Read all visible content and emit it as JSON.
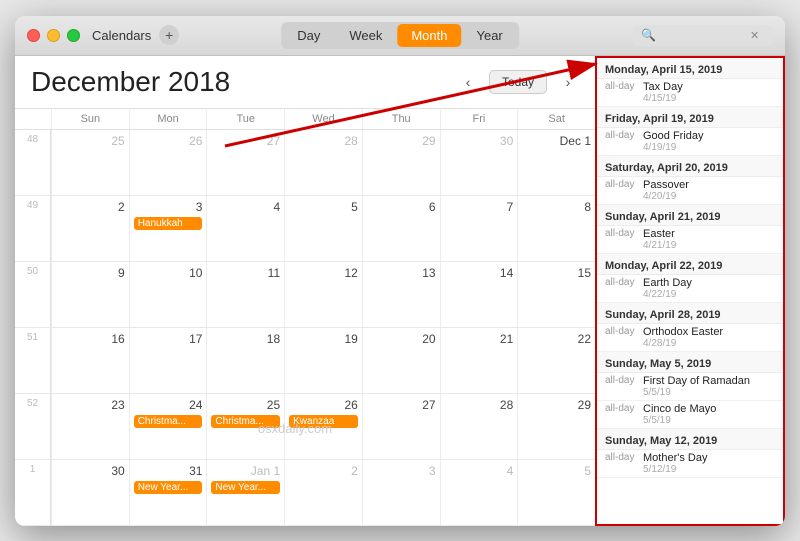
{
  "window": {
    "title": "Calendar"
  },
  "titlebar": {
    "calendars_label": "Calendars",
    "add_label": "+",
    "tabs": [
      "Day",
      "Week",
      "Month",
      "Year"
    ],
    "active_tab": "Month",
    "search_placeholder": ".",
    "search_clear": "✕"
  },
  "calendar": {
    "month_title": "December 2018",
    "prev_label": "‹",
    "next_label": "›",
    "today_label": "Today",
    "day_headers": [
      "Sun",
      "Mon",
      "Tue",
      "Wed",
      "Thu",
      "Fri",
      "Sat"
    ],
    "rows": [
      {
        "week_num": "48",
        "days": [
          {
            "num": "25",
            "other": true,
            "events": []
          },
          {
            "num": "26",
            "other": true,
            "events": []
          },
          {
            "num": "27",
            "other": true,
            "events": []
          },
          {
            "num": "28",
            "other": true,
            "events": []
          },
          {
            "num": "29",
            "other": true,
            "events": []
          },
          {
            "num": "30",
            "other": true,
            "events": []
          },
          {
            "num": "Dec 1",
            "other": false,
            "events": []
          }
        ]
      },
      {
        "week_num": "49",
        "days": [
          {
            "num": "2",
            "other": false,
            "events": []
          },
          {
            "num": "3",
            "other": false,
            "events": [
              {
                "label": "Hanukkah",
                "color": "orange"
              }
            ]
          },
          {
            "num": "4",
            "other": false,
            "events": []
          },
          {
            "num": "5",
            "other": false,
            "events": []
          },
          {
            "num": "6",
            "other": false,
            "events": []
          },
          {
            "num": "7",
            "other": false,
            "events": []
          },
          {
            "num": "8",
            "other": false,
            "events": []
          }
        ]
      },
      {
        "week_num": "50",
        "days": [
          {
            "num": "9",
            "other": false,
            "events": []
          },
          {
            "num": "10",
            "other": false,
            "events": []
          },
          {
            "num": "11",
            "other": false,
            "events": []
          },
          {
            "num": "12",
            "other": false,
            "events": []
          },
          {
            "num": "13",
            "other": false,
            "events": []
          },
          {
            "num": "14",
            "other": false,
            "events": []
          },
          {
            "num": "15",
            "other": false,
            "events": []
          }
        ]
      },
      {
        "week_num": "51",
        "days": [
          {
            "num": "16",
            "other": false,
            "events": []
          },
          {
            "num": "17",
            "other": false,
            "events": []
          },
          {
            "num": "18",
            "other": false,
            "events": []
          },
          {
            "num": "19",
            "other": false,
            "events": []
          },
          {
            "num": "20",
            "other": false,
            "events": []
          },
          {
            "num": "21",
            "other": false,
            "events": []
          },
          {
            "num": "22",
            "other": false,
            "events": []
          }
        ]
      },
      {
        "week_num": "52",
        "days": [
          {
            "num": "23",
            "other": false,
            "events": []
          },
          {
            "num": "24",
            "other": false,
            "events": [
              {
                "label": "Christma...",
                "color": "orange"
              }
            ]
          },
          {
            "num": "25",
            "other": false,
            "events": [
              {
                "label": "Christma...",
                "color": "orange"
              }
            ]
          },
          {
            "num": "26",
            "other": false,
            "events": [
              {
                "label": "Kwanzaa",
                "color": "orange"
              }
            ]
          },
          {
            "num": "27",
            "other": false,
            "events": []
          },
          {
            "num": "28",
            "other": false,
            "events": []
          },
          {
            "num": "29",
            "other": false,
            "events": []
          }
        ]
      },
      {
        "week_num": "1",
        "days": [
          {
            "num": "30",
            "other": false,
            "events": []
          },
          {
            "num": "31",
            "other": false,
            "events": [
              {
                "label": "New Year...",
                "color": "orange"
              }
            ]
          },
          {
            "num": "Jan 1",
            "other": true,
            "events": [
              {
                "label": "New Year...",
                "color": "orange"
              }
            ]
          },
          {
            "num": "2",
            "other": true,
            "events": []
          },
          {
            "num": "3",
            "other": true,
            "events": []
          },
          {
            "num": "4",
            "other": true,
            "events": []
          },
          {
            "num": "5",
            "other": true,
            "events": []
          }
        ]
      }
    ]
  },
  "search_results": {
    "groups": [
      {
        "date_header": "Monday, April 15, 2019",
        "events": [
          {
            "time": "all-day",
            "name": "Tax Day",
            "date": "4/15/19"
          }
        ]
      },
      {
        "date_header": "Friday, April 19, 2019",
        "events": [
          {
            "time": "all-day",
            "name": "Good Friday",
            "date": "4/19/19"
          }
        ]
      },
      {
        "date_header": "Saturday, April 20, 2019",
        "events": [
          {
            "time": "all-day",
            "name": "Passover",
            "date": "4/20/19"
          }
        ]
      },
      {
        "date_header": "Sunday, April 21, 2019",
        "events": [
          {
            "time": "all-day",
            "name": "Easter",
            "date": "4/21/19"
          }
        ]
      },
      {
        "date_header": "Monday, April 22, 2019",
        "events": [
          {
            "time": "all-day",
            "name": "Earth Day",
            "date": "4/22/19"
          }
        ]
      },
      {
        "date_header": "Sunday, April 28, 2019",
        "events": [
          {
            "time": "all-day",
            "name": "Orthodox Easter",
            "date": "4/28/19"
          }
        ]
      },
      {
        "date_header": "Sunday, May 5, 2019",
        "events": [
          {
            "time": "all-day",
            "name": "First Day of Ramadan",
            "date": "5/5/19"
          },
          {
            "time": "all-day",
            "name": "Cinco de Mayo",
            "date": "5/5/19"
          }
        ]
      },
      {
        "date_header": "Sunday, May 12, 2019",
        "events": [
          {
            "time": "all-day",
            "name": "Mother's Day",
            "date": "5/12/19"
          }
        ]
      }
    ]
  },
  "watermark": "osxdaily.com"
}
